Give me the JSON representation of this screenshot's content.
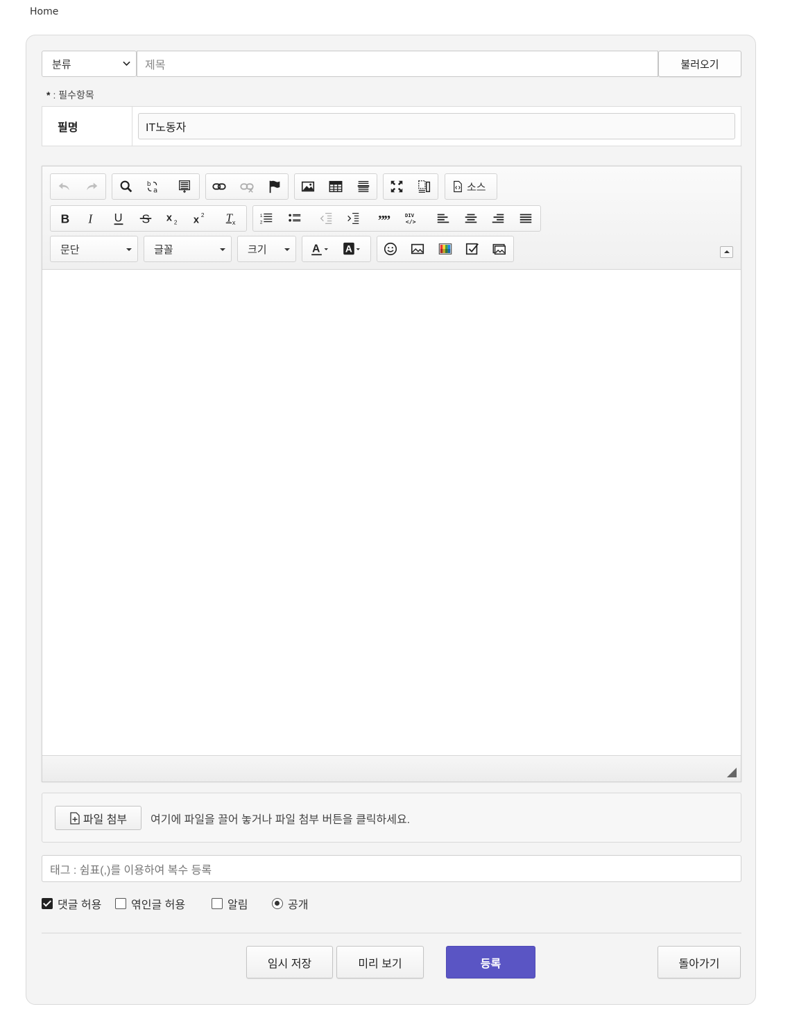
{
  "breadcrumb": {
    "home": "Home"
  },
  "form": {
    "category": {
      "label": "분류"
    },
    "title_placeholder": "제목",
    "load_button": "불러오기",
    "required_note": {
      "star": "*",
      "text": ": 필수항목"
    },
    "nickname": {
      "label": "필명",
      "value": "IT노동자"
    }
  },
  "editor": {
    "toolbar": {
      "row1": [
        "undo-icon",
        "redo-icon",
        "find-icon",
        "replace-icon",
        "select-all-icon",
        "link-icon",
        "unlink-icon",
        "anchor-icon",
        "image-icon",
        "table-icon",
        "horizontal-rule-icon",
        "maximize-icon",
        "show-blocks-icon",
        "source-icon"
      ],
      "source_label": "소스",
      "row2": [
        "bold-icon",
        "italic-icon",
        "underline-icon",
        "strike-icon",
        "subscript-icon",
        "superscript-icon",
        "remove-format-icon",
        "numbered-list-icon",
        "bulleted-list-icon",
        "outdent-icon",
        "indent-icon",
        "blockquote-icon",
        "div-icon",
        "align-left-icon",
        "align-center-icon",
        "align-right-icon",
        "align-justify-icon"
      ],
      "format_combo": "문단",
      "font_combo": "글꼴",
      "size_combo": "크기",
      "row3": [
        "text-color-icon",
        "background-color-icon",
        "emoji-icon",
        "image-upload-icon",
        "color-grid-icon",
        "checkbox-icon",
        "image-gallery-icon"
      ]
    }
  },
  "attach": {
    "button_label": "파일 첨부",
    "hint": "여기에 파일을 끌어 놓거나 파일 첨부 버튼을 클릭하세요."
  },
  "tags": {
    "placeholder": "태그 : 쉼표(,)를 이용하여 복수 등록"
  },
  "options": {
    "allow_comments": {
      "label": "댓글 허용",
      "checked": true
    },
    "allow_trackback": {
      "label": "엮인글 허용",
      "checked": false
    },
    "notify": {
      "label": "알림",
      "checked": false
    },
    "public": {
      "label": "공개",
      "checked": true
    }
  },
  "actions": {
    "temp_save": "임시 저장",
    "preview": "미리 보기",
    "submit": "등록",
    "back": "돌아가기"
  },
  "colors": {
    "primary": "#5a55c4",
    "panel_bg": "#f4f4f4"
  }
}
